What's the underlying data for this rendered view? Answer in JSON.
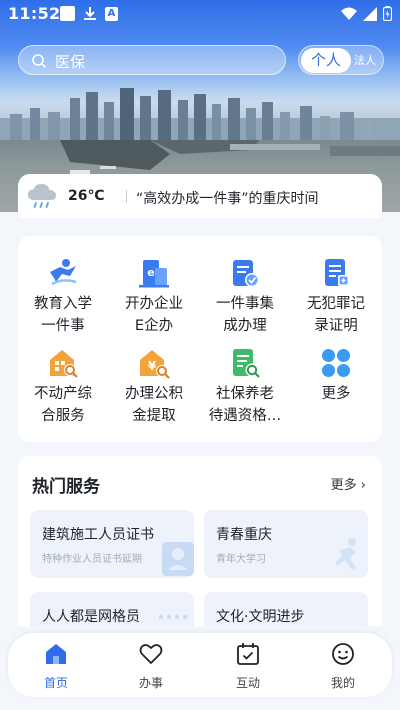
{
  "status_bar": {
    "time": "11:52",
    "icon_a": "A"
  },
  "search": {
    "placeholder": "医保"
  },
  "identity_segment": {
    "personal": "个人",
    "legal": "法人"
  },
  "weather": {
    "temperature": "26℃",
    "slogan": "“高效办成一件事”的重庆时间",
    "icon": "cloud-rain-icon"
  },
  "services": [
    {
      "label": "教育入学一件事",
      "icon": "student-icon"
    },
    {
      "label": "开办企业E企办",
      "icon": "enterprise-icon"
    },
    {
      "label": "一件事集成办理",
      "icon": "document-check-icon"
    },
    {
      "label": "无犯罪记录证明",
      "icon": "certificate-icon"
    },
    {
      "label": "不动产综合服务",
      "icon": "house-search-icon"
    },
    {
      "label": "办理公积金提取",
      "icon": "housing-fund-icon"
    },
    {
      "label": "社保养老待遇资格…",
      "icon": "pension-search-icon"
    },
    {
      "label": "更多",
      "icon": "grid-more-icon"
    }
  ],
  "hot_services": {
    "title": "热门服务",
    "more": "更多",
    "items": [
      {
        "title": "建筑施工人员证书",
        "subtitle": "特种作业人员证书延期"
      },
      {
        "title": "青春重庆",
        "subtitle": "青年大学习"
      },
      {
        "title": "人人都是网格员",
        "subtitle": ""
      },
      {
        "title": "文化·文明进步",
        "subtitle": ""
      }
    ]
  },
  "bottom_nav": [
    {
      "label": "首页",
      "icon": "home-icon",
      "active": true
    },
    {
      "label": "办事",
      "icon": "heart-icon",
      "active": false
    },
    {
      "label": "互动",
      "icon": "calendar-check-icon",
      "active": false
    },
    {
      "label": "我的",
      "icon": "smiley-icon",
      "active": false
    }
  ],
  "colors": {
    "accent": "#2f6ee8",
    "background": "#f3f6fb",
    "icon_blue": "#3a7bf0",
    "icon_orange": "#f2a33a",
    "icon_green": "#3dbb6a"
  }
}
